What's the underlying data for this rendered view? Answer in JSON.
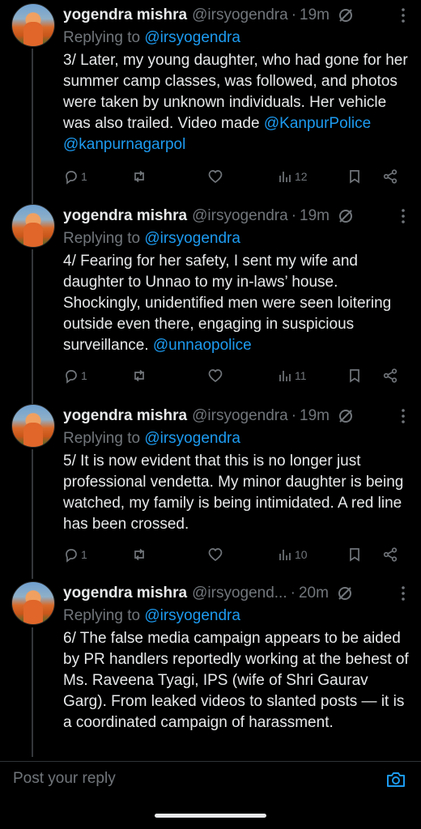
{
  "tweets": [
    {
      "name": "yogendra mishra",
      "handle": "@irsyogendra",
      "sep": "·",
      "time": "19m",
      "replying_prefix": "Replying to ",
      "replying_handle": "@irsyogendra",
      "text": "3/ Later, my young daughter, who had gone for her summer camp classes, was followed, and photos were taken by unknown individuals. Her vehicle was also trailed. Video made ",
      "mentions": "@KanpurPolice @kanpurnagarpol",
      "replies": "1",
      "views": "12"
    },
    {
      "name": "yogendra mishra",
      "handle": "@irsyogendra",
      "sep": "·",
      "time": "19m",
      "replying_prefix": "Replying to ",
      "replying_handle": "@irsyogendra",
      "text": "4/ Fearing for her safety, I sent my wife and daughter to Unnao to my in-laws’ house. Shockingly, unidentified men were seen loitering outside even there, engaging in suspicious surveillance. ",
      "mentions": "@unnaopolice",
      "replies": "1",
      "views": "11"
    },
    {
      "name": "yogendra mishra",
      "handle": "@irsyogendra",
      "sep": "·",
      "time": "19m",
      "replying_prefix": "Replying to ",
      "replying_handle": "@irsyogendra",
      "text": "5/ It is now evident that this is no longer just professional vendetta. My minor daughter is being watched, my family is being intimidated. A red line has been crossed.",
      "mentions": "",
      "replies": "1",
      "views": "10"
    },
    {
      "name": "yogendra mishra",
      "handle": "@irsyogend...",
      "sep": "·",
      "time": "20m",
      "replying_prefix": "Replying to ",
      "replying_handle": "@irsyogendra",
      "text": "6/ The false media campaign appears to be aided by PR handlers reportedly working at the behest of Ms. Raveena Tyagi, IPS (wife of Shri Gaurav Garg). From leaked videos to slanted posts — it is a coordinated campaign of harassment.",
      "mentions": "",
      "replies": "",
      "views": ""
    }
  ],
  "composer": {
    "placeholder": "Post your reply"
  },
  "colors": {
    "accent": "#1d9bf0",
    "muted": "#71767b",
    "text": "#e7e9ea",
    "background": "#000000"
  },
  "icons": [
    "reply-icon",
    "retweet-icon",
    "like-icon",
    "views-icon",
    "bookmark-icon",
    "share-icon",
    "grok-icon",
    "more-icon",
    "camera-icon"
  ]
}
